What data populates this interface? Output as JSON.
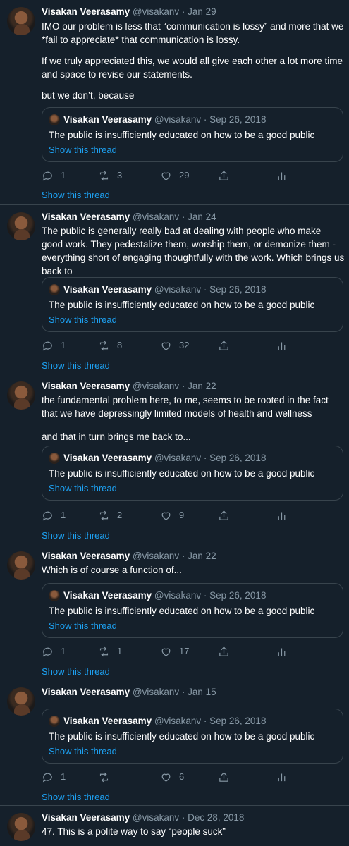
{
  "tweets": [
    {
      "name": "Visakan Veerasamy",
      "handle": "@visakanv",
      "date": "Jan 29",
      "paragraphs": [
        "IMO our problem is less that “communication is lossy” and more that we *fail to appreciate* that communication is lossy.",
        "If we truly appreciated this, we would all give each other a lot more time and space to revise our statements.",
        "but we don’t, because"
      ],
      "quote": {
        "name": "Visakan Veerasamy",
        "handle": "@visakanv",
        "date": "Sep 26, 2018",
        "text": "The public is insufficiently educated on how to be a good public",
        "show": "Show this thread"
      },
      "replies": "1",
      "retweets": "3",
      "likes": "29",
      "show_thread": "Show this thread"
    },
    {
      "name": "Visakan Veerasamy",
      "handle": "@visakanv",
      "date": "Jan 24",
      "paragraphs": [
        "The public is generally really bad at dealing with people who make good work. They pedestalize them, worship them, or demonize them - everything short of engaging thoughtfully with the work. Which brings us back to"
      ],
      "quote": {
        "name": "Visakan Veerasamy",
        "handle": "@visakanv",
        "date": "Sep 26, 2018",
        "text": "The public is insufficiently educated on how to be a good public",
        "show": "Show this thread"
      },
      "replies": "1",
      "retweets": "8",
      "likes": "32",
      "show_thread": "Show this thread"
    },
    {
      "name": "Visakan Veerasamy",
      "handle": "@visakanv",
      "date": "Jan 22",
      "paragraphs": [
        "the fundamental problem here, to me, seems to be rooted in the fact that we have depressingly limited models of health and wellness",
        "and that in turn brings me back to..."
      ],
      "quote": {
        "name": "Visakan Veerasamy",
        "handle": "@visakanv",
        "date": "Sep 26, 2018",
        "text": "The public is insufficiently educated on how to be a good public",
        "show": "Show this thread"
      },
      "replies": "1",
      "retweets": "2",
      "likes": "9",
      "show_thread": "Show this thread"
    },
    {
      "name": "Visakan Veerasamy",
      "handle": "@visakanv",
      "date": "Jan 22",
      "paragraphs": [
        "Which is of course a function of..."
      ],
      "quote": {
        "name": "Visakan Veerasamy",
        "handle": "@visakanv",
        "date": "Sep 26, 2018",
        "text": "The public is insufficiently educated on how to be a good public",
        "show": "Show this thread"
      },
      "replies": "1",
      "retweets": "1",
      "likes": "17",
      "show_thread": "Show this thread"
    },
    {
      "name": "Visakan Veerasamy",
      "handle": "@visakanv",
      "date": "Jan 15",
      "paragraphs": [],
      "quote": {
        "name": "Visakan Veerasamy",
        "handle": "@visakanv",
        "date": "Sep 26, 2018",
        "text": "The public is insufficiently educated on how to be a good public",
        "show": "Show this thread"
      },
      "replies": "1",
      "retweets": "",
      "likes": "6",
      "show_thread": "Show this thread"
    },
    {
      "name": "Visakan Veerasamy",
      "handle": "@visakanv",
      "date": "Dec 28, 2018",
      "paragraphs": [
        "47. This is a polite way to say “people suck”"
      ]
    }
  ],
  "colors": {
    "background": "#15202b",
    "border": "#38444d",
    "muted": "#8899a6",
    "link": "#1da1f2",
    "text": "#ffffff"
  },
  "icons": [
    "reply-icon",
    "retweet-icon",
    "like-icon",
    "share-icon",
    "analytics-icon"
  ]
}
